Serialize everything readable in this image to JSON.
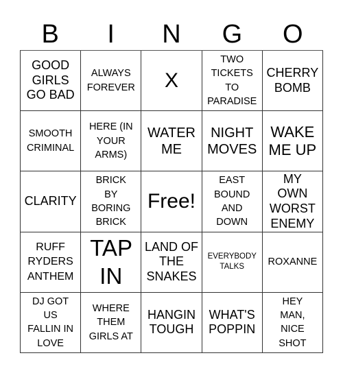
{
  "header": {
    "letters": [
      "B",
      "I",
      "N",
      "G",
      "O"
    ]
  },
  "cells": [
    "GOOD GIRLS GO BAD",
    "ALWAYS FOREVER",
    "X",
    "TWO TICKETS TO PARADISE",
    "CHERRY BOMB",
    "SMOOTH CRIMINAL",
    "HERE (IN YOUR ARMS)",
    "WATER ME",
    "NIGHT MOVES",
    "WAKE ME UP",
    "CLARITY",
    "BRICK BY BORING BRICK",
    "Free!",
    "EAST BOUND AND DOWN",
    "MY OWN WORST ENEMY",
    "RUFF RYDERS ANTHEM",
    "TAP IN",
    "LAND OF THE SNAKES",
    "EVERYBODY TALKS",
    "ROXANNE",
    "DJ GOT US FALLIN IN LOVE",
    "WHERE THEM GIRLS AT",
    "HANGIN TOUGH",
    "WHAT'S POPPIN",
    "HEY MAN, NICE SHOT"
  ]
}
